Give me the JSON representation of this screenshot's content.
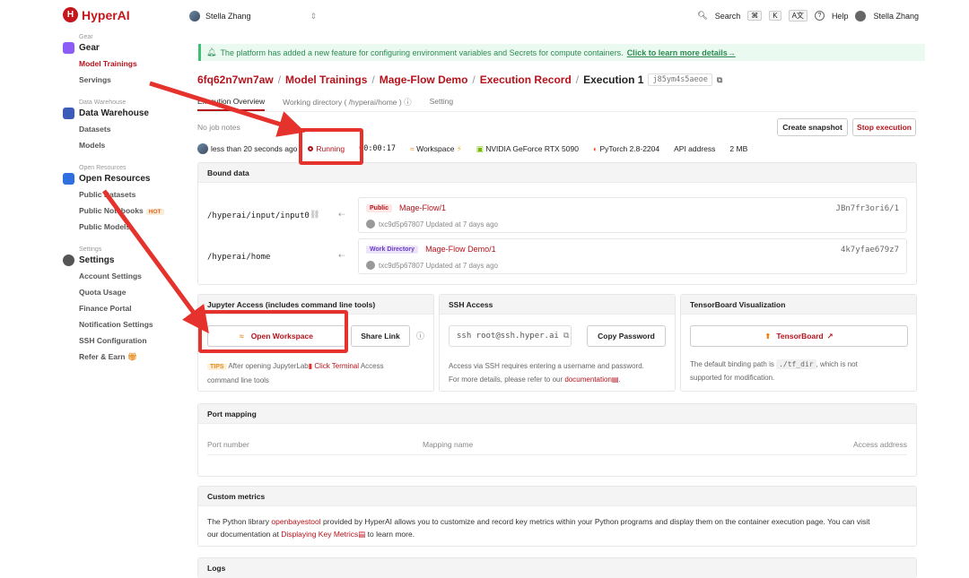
{
  "brand": {
    "name": "HyperAI"
  },
  "topbar": {
    "user_switch": "Stella Zhang",
    "search": "Search",
    "kbd_cmd": "⌘",
    "kbd_k": "K",
    "help": "Help",
    "user": "Stella Zhang"
  },
  "sidebar": {
    "gear": {
      "caption": "Gear",
      "title": "Gear",
      "items": [
        "Model Trainings",
        "Servings"
      ]
    },
    "warehouse": {
      "caption": "Data Warehouse",
      "title": "Data Warehouse",
      "items": [
        "Datasets",
        "Models"
      ]
    },
    "open": {
      "caption": "Open Resources",
      "title": "Open Resources",
      "items": [
        "Public Datasets",
        "Public Notebooks",
        "Public Models"
      ],
      "hot": "HOT"
    },
    "settings": {
      "caption": "Settings",
      "title": "Settings",
      "items": [
        "Account Settings",
        "Quota Usage",
        "Finance Portal",
        "Notification Settings",
        "SSH Configuration",
        "Refer & Earn"
      ]
    }
  },
  "notice": {
    "text": "The platform has added a new feature for configuring environment variables and Secrets for compute containers.",
    "link": "Click to learn more details→"
  },
  "breadcrumb": {
    "items": [
      "6fq62n7wn7aw",
      "Model Trainings",
      "Mage-Flow Demo",
      "Execution Record"
    ],
    "current": "Execution 1",
    "hash": "j85ym4s5aeoe"
  },
  "tabs": [
    "Execution Overview",
    "Working directory ( /hyperai/home )",
    "Setting"
  ],
  "job_notes": "No job notes",
  "actions": {
    "create_snapshot": "Create snapshot",
    "stop_execution": "Stop execution"
  },
  "status": {
    "started": "less than 20 seconds ago",
    "state": "Running",
    "duration": "00:00:17",
    "workspace": "Workspace",
    "gpu": "NVIDIA GeForce RTX 5090",
    "framework": "PyTorch 2.8-2204",
    "api": "API address",
    "size": "2 MB"
  },
  "bound_data": {
    "title": "Bound data",
    "rows": [
      {
        "path": "/hyperai/input/input0",
        "tag": "Public",
        "name": "Mage-Flow/1",
        "id": "JBn7fr3ori6/1",
        "meta": "txc9d5p67807 Updated at 7 days ago"
      },
      {
        "path": "/hyperai/home",
        "tag": "Work Directory",
        "name": "Mage-Flow Demo/1",
        "id": "4k7yfae679z7",
        "meta": "txc9d5p67807 Updated at 7 days ago"
      }
    ]
  },
  "jupyter": {
    "title": "Jupyter Access (includes command line tools)",
    "open_workspace": "Open Workspace",
    "share_link": "Share Link",
    "tips": "TIPS",
    "tip_text_1": "After opening JupyterLab",
    "tip_link": "Click Terminal",
    "tip_text_2": "Access",
    "tip_text_3": "command line tools"
  },
  "ssh": {
    "title": "SSH Access",
    "command": "ssh root@ssh.hyper.ai",
    "copy_password": "Copy Password",
    "desc_1": "Access via SSH requires entering a username and password.",
    "desc_2": "For more details, please refer to our",
    "doc_link": "documentation"
  },
  "tensorboard": {
    "title": "TensorBoard Visualization",
    "button": "TensorBoard",
    "desc_1": "The default binding path is",
    "path": "./tf_dir",
    "desc_2": ", which is not",
    "desc_3": "supported for modification."
  },
  "port_mapping": {
    "title": "Port mapping",
    "cols": [
      "Port number",
      "Mapping name",
      "Access address"
    ]
  },
  "custom_metrics": {
    "title": "Custom metrics",
    "text_1": "The Python library",
    "lib": "openbayestool",
    "text_2": "provided by HyperAI allows you to customize and record key metrics within your Python programs and display them on the container execution page. You can visit",
    "text_3": "our documentation at",
    "link": "Displaying Key Metrics",
    "text_4": "to learn more."
  },
  "logs": {
    "title": "Logs"
  },
  "colors": {
    "brand": "#c4161c",
    "arrow": "#e5322d",
    "notice_bg": "#eafaf0"
  }
}
